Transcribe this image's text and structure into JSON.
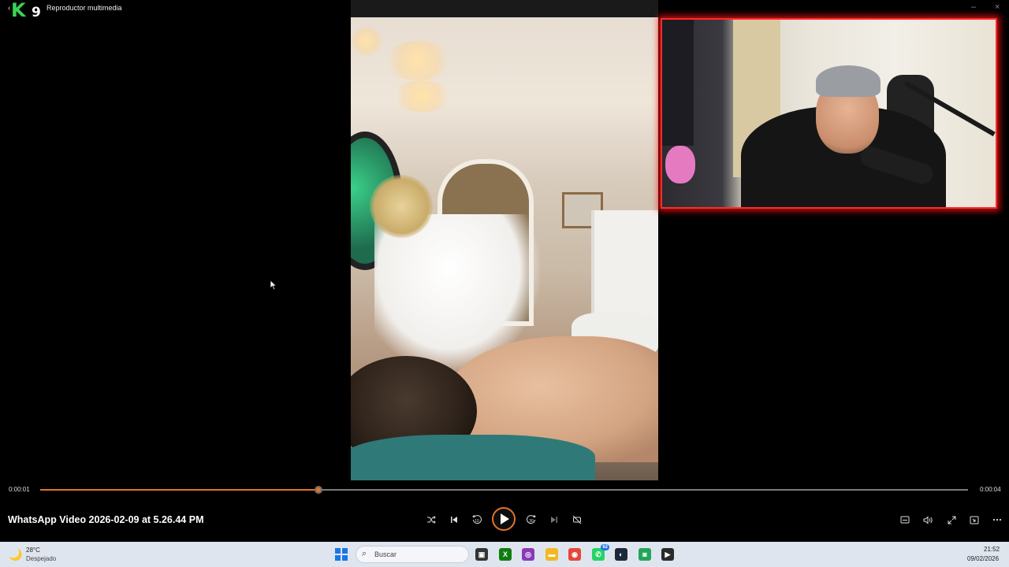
{
  "window": {
    "title": "Reproductor multimedia"
  },
  "player": {
    "file_name": "WhatsApp Video 2026-02-09 at 5.26.44 PM",
    "current_time": "0:00:01",
    "total_time": "0:00:04",
    "progress": 0.3,
    "accent_color": "#e2722a"
  },
  "controls": {
    "shuffle_icon": "shuffle-icon",
    "previous_icon": "skip-previous-icon",
    "rewind_icon": "rewind-10-icon",
    "rewind_label": "10",
    "play_icon": "play-icon",
    "forward_icon": "forward-30-icon",
    "forward_label": "30",
    "next_icon": "skip-next-icon",
    "repeat_icon": "repeat-off-icon",
    "subtitles_icon": "captions-icon",
    "volume_icon": "volume-icon",
    "fullscreen_icon": "fullscreen-icon",
    "miniplayer_icon": "mini-player-icon",
    "more_icon": "more-options-icon"
  },
  "overlay": {
    "webcam_border_color": "#ff2b2b"
  },
  "taskbar": {
    "weather_temp": "28°C",
    "weather_desc": "Despejado",
    "search_placeholder": "Buscar",
    "clock_time": "21:52",
    "clock_date": "09/02/2026",
    "apps": [
      {
        "name": "task-view",
        "color": "#333333",
        "glyph": "▣"
      },
      {
        "name": "xbox",
        "color": "#107c10",
        "glyph": "X"
      },
      {
        "name": "photos",
        "color": "#8a3ab9",
        "glyph": "◎"
      },
      {
        "name": "file-explorer",
        "color": "#f2b824",
        "glyph": "▬"
      },
      {
        "name": "chrome",
        "color": "#e6463a",
        "glyph": "◉"
      },
      {
        "name": "whatsapp",
        "color": "#25d366",
        "glyph": "✆",
        "badge": "62"
      },
      {
        "name": "steam",
        "color": "#1b2838",
        "glyph": "◐"
      },
      {
        "name": "discord",
        "color": "#23a559",
        "glyph": "◙"
      },
      {
        "name": "media-player",
        "color": "#2a2a2a",
        "glyph": "▶"
      }
    ]
  }
}
